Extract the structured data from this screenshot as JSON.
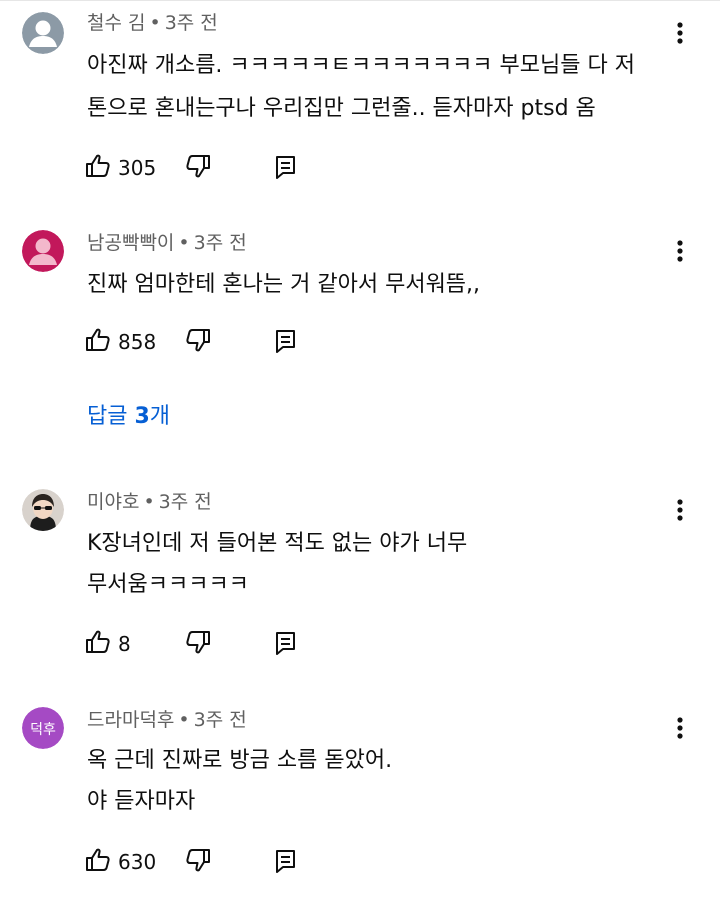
{
  "comments": [
    {
      "author": "철수 김",
      "time": "3주 전",
      "separator": "•",
      "avatar_color": "#8c9aa6",
      "lines": [
        "아진짜 개소름. ㅋㅋㅋㅋㅋㅌㅋㅋㅋㅋㅋㅋㅋ 부모님들 다 저",
        "톤으로 혼내는구나 우리집만 그런줄.. 듣자마자 ptsd 옴"
      ],
      "likes": "305"
    },
    {
      "author": "남공빡빡이",
      "time": "3주 전",
      "separator": "•",
      "avatar_color": "#c2185b",
      "lines": [
        "진짜 엄마한테 혼나는 거 같아서 무서워뜸,,"
      ],
      "likes": "858",
      "replies": {
        "prefix": "답글 ",
        "count": "3",
        "suffix": "개"
      }
    },
    {
      "author": "미야호",
      "time": "3주 전",
      "separator": "•",
      "avatar_color": "#d8d2cc",
      "lines": [
        "K장녀인데 저 들어본 적도 없는 야가 너무",
        "무서움ㅋㅋㅋㅋㅋ"
      ],
      "likes": "8"
    },
    {
      "author": "드라마덕후",
      "time": "3주 전",
      "separator": "•",
      "avatar_color": "#a54ac4",
      "avatar_text": "덕후",
      "lines": [
        "옥 근데 진짜로 방금 소름 돋았어.",
        "야 듣자마자"
      ],
      "likes": "630"
    }
  ],
  "icons": {
    "like": "thumb-up-icon",
    "dislike": "thumb-down-icon",
    "reply": "reply-icon",
    "more": "more-vertical-icon"
  },
  "colors": {
    "text": "#0f0f0f",
    "meta": "#606060",
    "link": "#065fd4"
  }
}
